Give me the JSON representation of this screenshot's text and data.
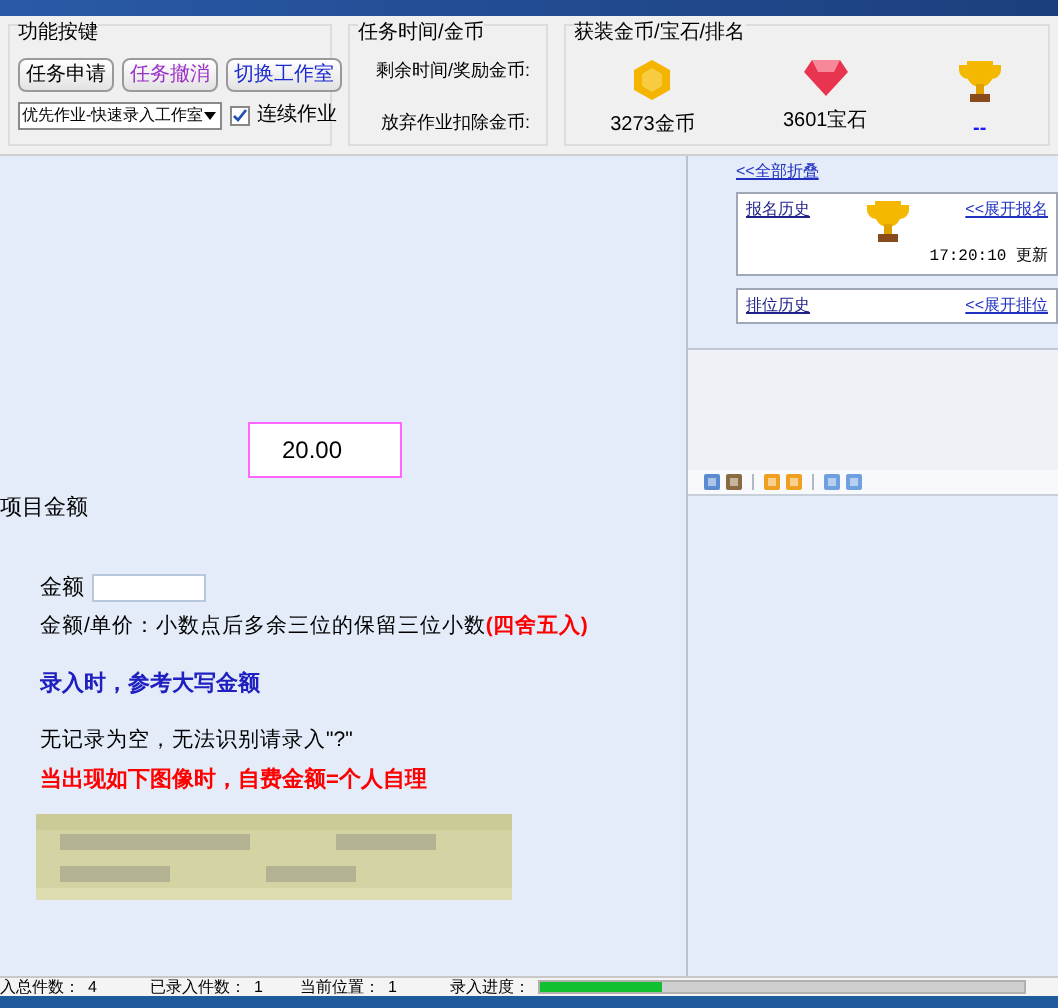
{
  "groups": [
    {
      "title": "功能按键"
    },
    {
      "title": "任务时间/金币"
    },
    {
      "title": "获装金币/宝石/排名"
    }
  ],
  "buttons": [
    {
      "label": "任务申请",
      "color": "#000000"
    },
    {
      "label": "任务撤消",
      "color": "#9b30c8"
    },
    {
      "label": "切换工作室",
      "color": "#1a2ad0"
    }
  ],
  "mode_select": {
    "value": "优先作业-快速录入工作室"
  },
  "continuous": {
    "label": "连续作业",
    "checked": true
  },
  "task_fields": [
    {
      "label": "剩余时间/奖励金币:"
    },
    {
      "label": "放弃作业扣除金币:"
    }
  ],
  "rewards": [
    {
      "kind": "coin",
      "text": "3273金币"
    },
    {
      "kind": "gem",
      "text": "3601宝石"
    },
    {
      "kind": "trophy",
      "text": "--"
    }
  ],
  "ranking": {
    "collapse_link": "<<全部折叠",
    "cards": [
      {
        "title": "报名历史",
        "action": "<<展开报名",
        "time": "17:20:10 更新",
        "trophy": true
      },
      {
        "title": "排位历史",
        "action": "<<展开排位",
        "trophy": false
      }
    ]
  },
  "amount_preview": {
    "value": "20.00"
  },
  "section_title": "项目金额",
  "form": {
    "label": "金额",
    "hint": "金额/单价：小数点后多余三位的保留三位小数",
    "hint_red": "(四舍五入)",
    "blue_note": "录入时，参考大写金额",
    "note": "无记录为空，无法识别请录入\"?\"",
    "red_note": "当出现如下图像时，自费金额=个人自理"
  },
  "status_bar": [
    {
      "label": "入总件数：",
      "value": "4"
    },
    {
      "label": "已录入件数：",
      "value": "1"
    },
    {
      "label": "当前位置：",
      "value": "1"
    },
    {
      "label": "录入进度：",
      "level": 0.25
    }
  ]
}
